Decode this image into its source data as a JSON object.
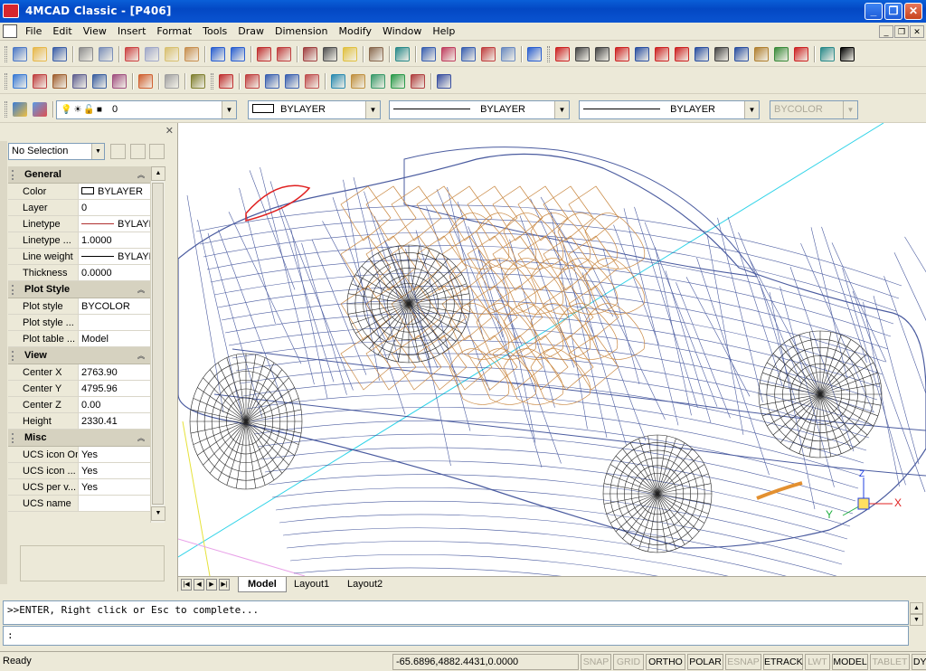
{
  "window": {
    "title": "4MCAD Classic  - [P406]"
  },
  "menu": [
    "File",
    "Edit",
    "View",
    "Insert",
    "Format",
    "Tools",
    "Draw",
    "Dimension",
    "Modify",
    "Window",
    "Help"
  ],
  "layer_bar": {
    "layer": "0",
    "color": "BYLAYER",
    "linetype": "BYLAYER",
    "lineweight": "BYLAYER",
    "plotstyle": "BYCOLOR"
  },
  "properties": {
    "selection": "No Selection",
    "categories": [
      {
        "name": "General",
        "rows": [
          {
            "key": "Color",
            "value": "BYLAYER"
          },
          {
            "key": "Layer",
            "value": "0"
          },
          {
            "key": "Linetype",
            "value": "BYLAYER"
          },
          {
            "key": "Linetype ...",
            "value": "1.0000"
          },
          {
            "key": "Line weight",
            "value": "BYLAYER"
          },
          {
            "key": "Thickness",
            "value": "0.0000"
          }
        ]
      },
      {
        "name": "Plot Style",
        "rows": [
          {
            "key": "Plot style",
            "value": "BYCOLOR"
          },
          {
            "key": "Plot style ...",
            "value": ""
          },
          {
            "key": "Plot table ...",
            "value": "Model"
          }
        ]
      },
      {
        "name": "View",
        "rows": [
          {
            "key": "Center X",
            "value": "2763.90"
          },
          {
            "key": "Center Y",
            "value": "4795.96"
          },
          {
            "key": "Center Z",
            "value": "0.00"
          },
          {
            "key": "Height",
            "value": "2330.41"
          }
        ]
      },
      {
        "name": "Misc",
        "rows": [
          {
            "key": "UCS icon On",
            "value": "Yes"
          },
          {
            "key": "UCS icon ...",
            "value": "Yes"
          },
          {
            "key": "UCS per v...",
            "value": "Yes"
          },
          {
            "key": "UCS name",
            "value": ""
          }
        ]
      }
    ]
  },
  "ucs": {
    "x": "X",
    "y": "Y",
    "z": "Z"
  },
  "tabs": [
    "Model",
    "Layout1",
    "Layout2"
  ],
  "command": {
    "history": ">>ENTER, Right click or Esc to complete...",
    "prompt": ":"
  },
  "status": {
    "ready": "Ready",
    "coords": "-65.6896,4882.4431,0.0000",
    "toggles": [
      {
        "label": "SNAP",
        "on": false
      },
      {
        "label": "GRID",
        "on": false
      },
      {
        "label": "ORTHO",
        "on": true
      },
      {
        "label": "POLAR",
        "on": true
      },
      {
        "label": "ESNAP",
        "on": false
      },
      {
        "label": "ETRACK",
        "on": true
      },
      {
        "label": "LWT",
        "on": false
      },
      {
        "label": "MODEL",
        "on": true
      },
      {
        "label": "TABLET",
        "on": false
      },
      {
        "label": "DYN",
        "on": true
      }
    ]
  },
  "colors": {
    "wire_blue": "#2b3f8f",
    "wire_orange": "#c8863f",
    "wire_dark": "#222222",
    "axis_cyan": "#2fd3e8",
    "axis_yellow": "#e6e23a"
  }
}
